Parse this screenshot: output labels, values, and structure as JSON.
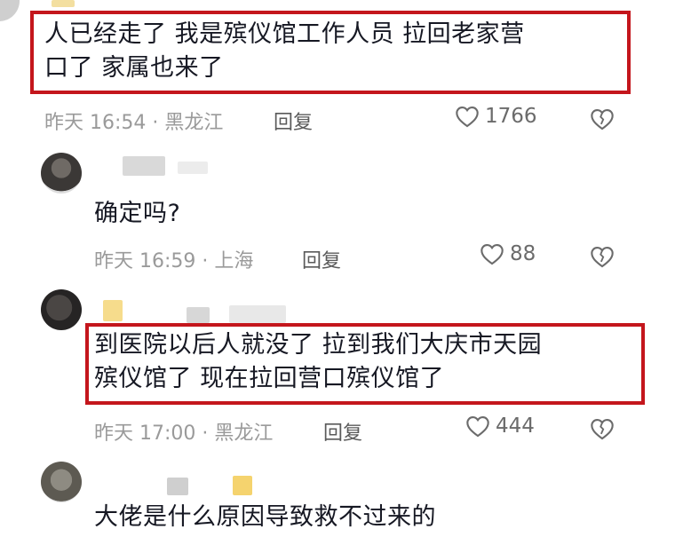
{
  "comments": [
    {
      "text_lines": [
        "人已经走了  我是殡仪馆工作人员  拉回老家营",
        "口了 家属也来了"
      ],
      "time": "昨天 16:54 · 黑龙江",
      "reply": "回复",
      "likes": "1766",
      "highlighted": true
    },
    {
      "text_lines": [
        "确定吗?"
      ],
      "time": "昨天 16:59 · 上海",
      "reply": "回复",
      "likes": "88",
      "highlighted": false
    },
    {
      "text_lines": [
        "到医院以后人就没了  拉到我们大庆市天园",
        "殡仪馆了  现在拉回营口殡仪馆了"
      ],
      "time": "昨天 17:00 · 黑龙江",
      "reply": "回复",
      "likes": "444",
      "highlighted": true
    },
    {
      "text_lines": [
        "大佬是什么原因导致救不过来的"
      ],
      "highlighted": false
    }
  ],
  "colors": {
    "highlight": "#c4161c",
    "meta": "#9a9a9a",
    "text": "#161823"
  },
  "icons": {
    "like": "heart-outline-icon",
    "dislike": "broken-heart-icon"
  }
}
